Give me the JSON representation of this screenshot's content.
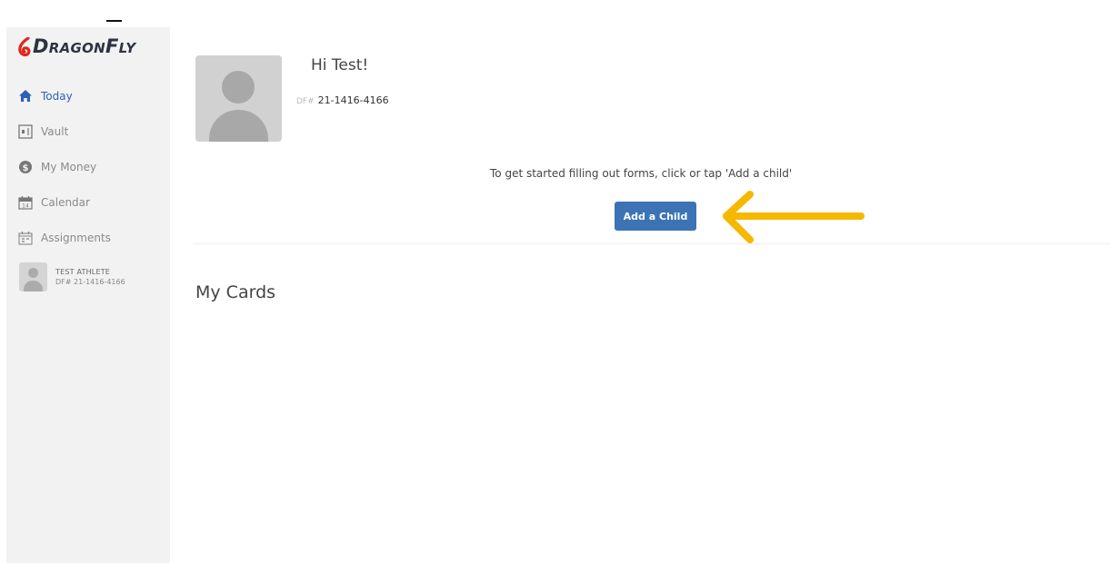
{
  "logo": {
    "brand": "DRAGONFLY",
    "first": "D",
    "mid": "RAGON",
    "f": "F",
    "end": "LY"
  },
  "sidebar": {
    "items": [
      {
        "label": "Today",
        "icon": "home-icon",
        "active": true
      },
      {
        "label": "Vault",
        "icon": "vault-icon",
        "active": false
      },
      {
        "label": "My Money",
        "icon": "money-icon",
        "active": false
      },
      {
        "label": "Calendar",
        "icon": "calendar-icon",
        "active": false
      },
      {
        "label": "Assignments",
        "icon": "assignments-icon",
        "active": false
      }
    ],
    "profile": {
      "name": "TEST ATHLETE",
      "id": "DF# 21-1416-4166"
    }
  },
  "header": {
    "greeting": "Hi Test!",
    "df_prefix": "DF#",
    "df_number": "21-1416-4166"
  },
  "main": {
    "instructions": "To get started filling out forms, click or tap 'Add a child'",
    "add_child_label": "Add a Child",
    "cards_title": "My Cards"
  },
  "colors": {
    "accent": "#3c73b5",
    "active_nav": "#2b62b8",
    "arrow": "#f5b800",
    "sidebar_bg": "#f2f2f2"
  }
}
